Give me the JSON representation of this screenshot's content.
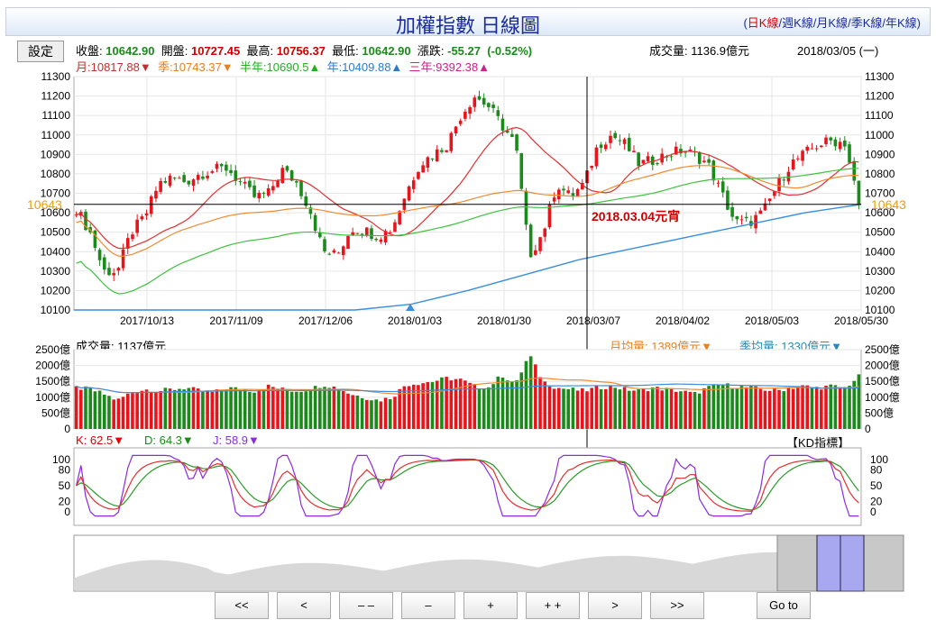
{
  "header": {
    "title": "加權指數  日線圖",
    "links": [
      "日K線",
      "週K線",
      "月K線",
      "季K線",
      "年K線"
    ]
  },
  "settings_label": "設定",
  "quote": {
    "close_label": "收盤:",
    "close": "10642.90",
    "open_label": "開盤:",
    "open": "10727.45",
    "high_label": "最高:",
    "high": "10756.37",
    "low_label": "最低:",
    "low": "10642.90",
    "change_label": "漲跌:",
    "change": "-55.27",
    "change_pct": "(-0.52%)",
    "volume": "成交量: 1136.9億元",
    "date": "2018/03/05 (一)"
  },
  "ma": {
    "month": "月:10817.88▼",
    "quarter": "季:10743.37▼",
    "half": "半年:10690.5▲",
    "year": "年:10409.88▲",
    "three_year": "三年:9392.38▲"
  },
  "colors": {
    "up": "#e8141b",
    "down": "#1a8a1a",
    "month": "#e03030",
    "quarter": "#f08a30",
    "half": "#40c040",
    "year": "#3a8ee0",
    "k": "#e03030",
    "d": "#2a9a2a",
    "j": "#8a2be2"
  },
  "chart_data": [
    {
      "type": "candlestick",
      "title": "加權指數 日線圖",
      "ylim": [
        10100,
        11300
      ],
      "yticks": [
        "11300",
        "11200",
        "11100",
        "11000",
        "10900",
        "10800",
        "10700",
        "10600",
        "10500",
        "10400",
        "10300",
        "10200",
        "10100"
      ],
      "xticks": [
        "2017/10/13",
        "2017/11/09",
        "2017/12/06",
        "2018/01/03",
        "2018/01/30",
        "2018/03/07",
        "2018/04/02",
        "2018/05/03",
        "2018/05/30"
      ],
      "crosshair_value": "10643",
      "annotation": "2018.03.04元宵",
      "close_waypoints": [
        10620,
        10500,
        10300,
        10300,
        10500,
        10580,
        10750,
        10780,
        10760,
        10800,
        10820,
        10830,
        10750,
        10680,
        10700,
        10820,
        10760,
        10620,
        10400,
        10380,
        10520,
        10510,
        10480,
        10520,
        10700,
        10850,
        10900,
        10950,
        11100,
        11200,
        11150,
        11050,
        10950,
        10380,
        10500,
        10750,
        10680,
        10750,
        10950,
        11000,
        10950,
        10850,
        10870,
        10900,
        10920,
        10900,
        10850,
        10700,
        10550,
        10550,
        10600,
        10730,
        10850,
        10900,
        10950,
        10970,
        10960,
        10643
      ],
      "year_line": [
        10100,
        10100,
        10100,
        10100,
        10100,
        10100,
        10130,
        10200,
        10280,
        10360,
        10420,
        10480,
        10540,
        10600,
        10643
      ]
    },
    {
      "type": "bar",
      "title": "成交量: 1137億元",
      "month_avg": "月均量: 1389億元▼",
      "quarter_avg": "季均量: 1330億元▼",
      "ylim": [
        0,
        2500
      ],
      "yticks": [
        "2500億",
        "2000億",
        "1500億",
        "1000億",
        "500億",
        "0"
      ],
      "volume_waypoints": [
        1300,
        1250,
        1100,
        900,
        1150,
        1250,
        1200,
        1250,
        1300,
        1200,
        1150,
        1300,
        1250,
        1200,
        1350,
        1250,
        1200,
        1250,
        1400,
        1300,
        1100,
        1000,
        900,
        1000,
        1400,
        1450,
        1500,
        1600,
        1550,
        1350,
        1300,
        1700,
        1400,
        2350,
        1500,
        1300,
        1250,
        1200,
        1300,
        1350,
        1250,
        1200,
        1300,
        1250,
        1200,
        1100,
        1300,
        1400,
        1350,
        1300,
        1250,
        1200,
        1300,
        1350,
        1300,
        1350,
        1300,
        1650
      ]
    },
    {
      "type": "line",
      "title": "KD指標",
      "k": "K: 62.5▼",
      "d": "D: 64.3▼",
      "j": "J: 58.9▼",
      "ylim": [
        -10,
        110
      ],
      "yticks": [
        "100",
        "80",
        "50",
        "20",
        "0"
      ]
    }
  ],
  "nav": [
    "<<",
    "<",
    "– –",
    "–",
    "+",
    "+ +",
    ">",
    ">>"
  ],
  "goto": "Go to"
}
